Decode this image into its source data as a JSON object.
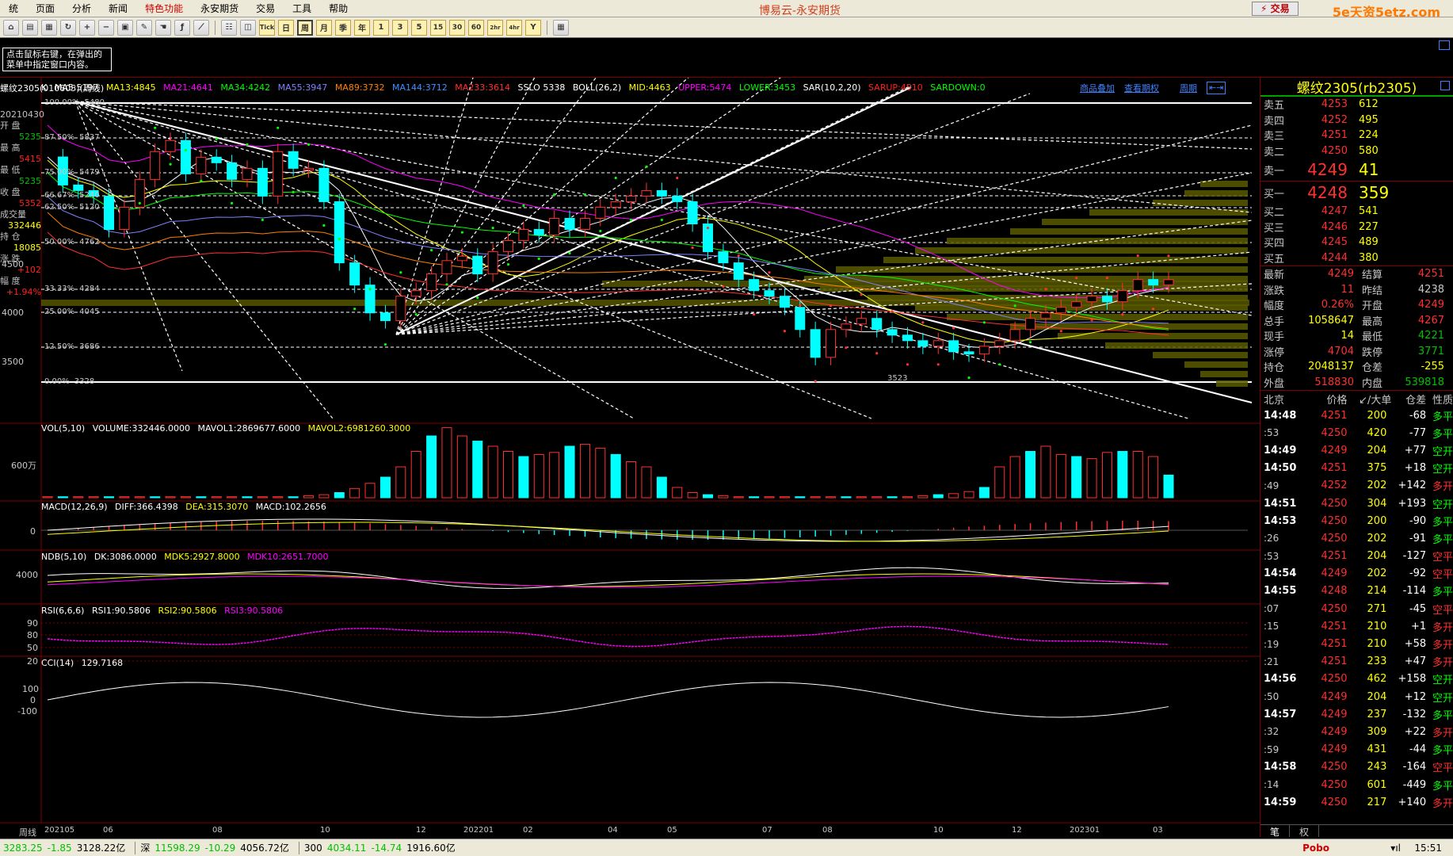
{
  "menu": {
    "items": [
      "统",
      "页面",
      "分析",
      "新闻",
      "特色功能",
      "永安期货",
      "交易",
      "工具",
      "帮助"
    ],
    "title": "博易云-永安期货",
    "trade_btn": "交易",
    "site": "5e天资5etz.com"
  },
  "toolbar": {
    "periods": [
      "Tick",
      "日",
      "周",
      "月",
      "季",
      "年",
      "1",
      "3",
      "5",
      "15",
      "30",
      "60",
      "2hr",
      "4hr",
      "Y"
    ]
  },
  "tip": "点击鼠标右键，在弹出的菜单中指定窗口内容。",
  "chart": {
    "header": {
      "contract": "螺纹2305(010605)(周线)",
      "k": "K",
      "ma5": "MA5:5197",
      "ma13": "MA13:4845",
      "ma21": "MA21:4641",
      "ma34": "MA34:4242",
      "ma55": "MA55:3947",
      "ma89": "MA89:3732",
      "ma144": "MA144:3712",
      "ma233": "MA233:3614",
      "sslo": "SSLO 5338",
      "boll": "BOLL(26,2)",
      "mid": "MID:4463",
      "upper": "UPPER:5474",
      "lower": "LOWER:3453",
      "sar": "SAR(10,2,20)",
      "sarup": "SARUP:4510",
      "sardown": "SARDOWN:0",
      "links": [
        "商品叠加",
        "查看期权",
        "周期"
      ]
    },
    "left_info": [
      {
        "label": "20210430",
        "value": ""
      },
      {
        "label": "开 盘",
        "value": "5235"
      },
      {
        "label": "最 高",
        "value": "5415"
      },
      {
        "label": "最 低",
        "value": "5235"
      },
      {
        "label": "收 盘",
        "value": "5352"
      },
      {
        "label": "成交量",
        "value": "332446"
      },
      {
        "label": "持 仓",
        "value": "18085"
      },
      {
        "label": "涨 跌",
        "value": "+102"
      },
      {
        "label": "幅 度",
        "value": "+1.94%"
      }
    ],
    "fib_levels": [
      {
        "pct": "100.00%",
        "price": "5480"
      },
      {
        "pct": "87.50%",
        "price": "5837"
      },
      {
        "pct": "75.00%",
        "price": "5479"
      },
      {
        "pct": "66.67%",
        "price": "5240"
      },
      {
        "pct": "62.50%",
        "price": "5120"
      },
      {
        "pct": "50.00%",
        "price": "4762"
      },
      {
        "pct": "33.33%",
        "price": "4284"
      },
      {
        "pct": "25.00%",
        "price": "4045"
      },
      {
        "pct": "12.50%",
        "price": "3686"
      },
      {
        "pct": "0.00%",
        "price": "3328"
      }
    ],
    "price_ticks": [
      "4500",
      "4000",
      "3500"
    ],
    "low_label": "3523",
    "vol": {
      "title": "VOL(5,10)",
      "volume": "VOLUME:332446.0000",
      "mavol1": "MAVOL1:2869677.6000",
      "mavol2": "MAVOL2:6981260.3000",
      "tick": "600万"
    },
    "macd": {
      "title": "MACD(12,26,9)",
      "diff": "DIFF:366.4398",
      "dea": "DEA:315.3070",
      "macd": "MACD:102.2656",
      "tick": "0"
    },
    "ndb": {
      "title": "NDB(5,10)",
      "dk": "DK:3086.0000",
      "mdk5": "MDK5:2927.8000",
      "mdk10": "MDK10:2651.7000",
      "tick": "4000"
    },
    "rsi": {
      "title": "RSI(6,6,6)",
      "rsi1": "RSI1:90.5806",
      "rsi2": "RSI2:90.5806",
      "rsi3": "RSI3:90.5806",
      "ticks": [
        "90",
        "80",
        "50",
        "20"
      ]
    },
    "cci": {
      "title": "CCI(14)",
      "value": "129.7168",
      "ticks": [
        "100",
        "0",
        "-100"
      ]
    },
    "xaxis": {
      "label": "周线",
      "ticks": [
        "202105",
        "06",
        "08",
        "10",
        "12",
        "202201",
        "02",
        "04",
        "05",
        "07",
        "08",
        "10",
        "12",
        "202301",
        "03"
      ]
    }
  },
  "quote": {
    "name": "螺纹2305(rb2305)",
    "asks": [
      {
        "label": "卖五",
        "price": "4253",
        "vol": "612"
      },
      {
        "label": "卖四",
        "price": "4252",
        "vol": "495"
      },
      {
        "label": "卖三",
        "price": "4251",
        "vol": "224"
      },
      {
        "label": "卖二",
        "price": "4250",
        "vol": "580"
      },
      {
        "label": "卖一",
        "price": "4249",
        "vol": "41"
      }
    ],
    "bids": [
      {
        "label": "买一",
        "price": "4248",
        "vol": "359"
      },
      {
        "label": "买二",
        "price": "4247",
        "vol": "541"
      },
      {
        "label": "买三",
        "price": "4246",
        "vol": "227"
      },
      {
        "label": "买四",
        "price": "4245",
        "vol": "489"
      },
      {
        "label": "买五",
        "price": "4244",
        "vol": "380"
      }
    ],
    "stats": [
      {
        "k": "最新",
        "v": "4249",
        "k2": "结算",
        "v2": "4251"
      },
      {
        "k": "涨跌",
        "v": "11",
        "k2": "昨结",
        "v2": "4238"
      },
      {
        "k": "幅度",
        "v": "0.26%",
        "k2": "开盘",
        "v2": "4249"
      },
      {
        "k": "总手",
        "v": "1058647",
        "k2": "最高",
        "v2": "4267"
      },
      {
        "k": "现手",
        "v": "14",
        "k2": "最低",
        "v2": "4221"
      },
      {
        "k": "涨停",
        "v": "4704",
        "k2": "跌停",
        "v2": "3771"
      },
      {
        "k": "持仓",
        "v": "2048137",
        "k2": "仓差",
        "v2": "-255"
      },
      {
        "k": "外盘",
        "v": "518830",
        "k2": "内盘",
        "v2": "539818"
      }
    ],
    "tick_header": [
      "北京",
      "价格",
      "↙/大单",
      "仓差",
      "性质"
    ],
    "ticks": [
      {
        "t": "14:48",
        "s": false,
        "p": "4251",
        "v": "200",
        "c": "-68",
        "tp": "多平"
      },
      {
        "t": ":53",
        "s": true,
        "p": "4250",
        "v": "420",
        "c": "-77",
        "tp": "多平"
      },
      {
        "t": "14:49",
        "s": false,
        "p": "4249",
        "v": "204",
        "c": "+77",
        "tp": "空开"
      },
      {
        "t": "14:50",
        "s": false,
        "p": "4251",
        "v": "375",
        "c": "+18",
        "tp": "空开"
      },
      {
        "t": ":49",
        "s": true,
        "p": "4252",
        "v": "202",
        "c": "+142",
        "tp": "多开"
      },
      {
        "t": "14:51",
        "s": false,
        "p": "4250",
        "v": "304",
        "c": "+193",
        "tp": "空开"
      },
      {
        "t": "14:53",
        "s": false,
        "p": "4250",
        "v": "200",
        "c": "-90",
        "tp": "多平"
      },
      {
        "t": ":26",
        "s": true,
        "p": "4250",
        "v": "202",
        "c": "-91",
        "tp": "多平"
      },
      {
        "t": ":53",
        "s": true,
        "p": "4251",
        "v": "204",
        "c": "-127",
        "tp": "空平"
      },
      {
        "t": "14:54",
        "s": false,
        "p": "4249",
        "v": "202",
        "c": "-92",
        "tp": "空平"
      },
      {
        "t": "14:55",
        "s": false,
        "p": "4248",
        "v": "214",
        "c": "-114",
        "tp": "多平"
      },
      {
        "t": ":07",
        "s": true,
        "p": "4250",
        "v": "271",
        "c": "-45",
        "tp": "空平"
      },
      {
        "t": ":15",
        "s": true,
        "p": "4251",
        "v": "210",
        "c": "+1",
        "tp": "多开"
      },
      {
        "t": ":19",
        "s": true,
        "p": "4251",
        "v": "210",
        "c": "+58",
        "tp": "多开"
      },
      {
        "t": ":21",
        "s": true,
        "p": "4251",
        "v": "233",
        "c": "+47",
        "tp": "多开"
      },
      {
        "t": "14:56",
        "s": false,
        "p": "4250",
        "v": "462",
        "c": "+158",
        "tp": "空开"
      },
      {
        "t": ":50",
        "s": true,
        "p": "4249",
        "v": "204",
        "c": "+12",
        "tp": "空开"
      },
      {
        "t": "14:57",
        "s": false,
        "p": "4249",
        "v": "237",
        "c": "-132",
        "tp": "多平"
      },
      {
        "t": ":32",
        "s": true,
        "p": "4249",
        "v": "309",
        "c": "+22",
        "tp": "多开"
      },
      {
        "t": ":59",
        "s": true,
        "p": "4249",
        "v": "431",
        "c": "-44",
        "tp": "多平"
      },
      {
        "t": "14:58",
        "s": false,
        "p": "4250",
        "v": "243",
        "c": "-164",
        "tp": "空平"
      },
      {
        "t": ":14",
        "s": true,
        "p": "4250",
        "v": "601",
        "c": "-449",
        "tp": "多平"
      },
      {
        "t": "14:59",
        "s": false,
        "p": "4250",
        "v": "217",
        "c": "+140",
        "tp": "多开"
      }
    ],
    "bottom_tabs": [
      "笔",
      "权"
    ]
  },
  "status": {
    "sh": "3283.25",
    "sh_chg": "-1.85",
    "sh_amt": "3128.22亿",
    "sz_label": "深",
    "sz": "11598.29",
    "sz_chg": "-10.29",
    "sz_amt": "4056.72亿",
    "c300_label": "300",
    "c300": "4034.11",
    "c300_chg": "-14.74",
    "c300_amt": "1916.60亿",
    "brand": "Pobo",
    "time": "15:51"
  },
  "colors": {
    "up": "#ff3030",
    "down": "#00ffff",
    "accent": "#ffff00",
    "bg": "#000000"
  }
}
